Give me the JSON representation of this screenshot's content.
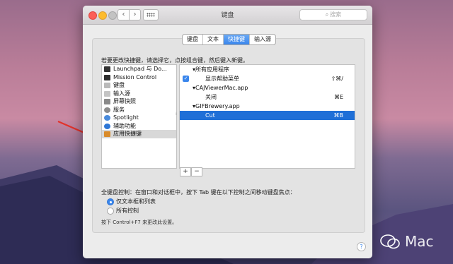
{
  "window": {
    "title": "键盘",
    "search_placeholder": "搜索",
    "nav_back": "‹",
    "nav_forward": "›"
  },
  "tabs": [
    {
      "label": "键盘",
      "active": false
    },
    {
      "label": "文本",
      "active": false
    },
    {
      "label": "快捷键",
      "active": true
    },
    {
      "label": "输入源",
      "active": false
    }
  ],
  "instruction": "若要更改快捷键，请选择它，点按组合键，然后键入新键。",
  "categories": [
    {
      "label": "Launchpad 与 Do...",
      "icon": "launchpad-icon",
      "color": "#333333",
      "selected": false
    },
    {
      "label": "Mission Control",
      "icon": "mission-control-icon",
      "color": "#2d2d2d",
      "selected": false
    },
    {
      "label": "键盘",
      "icon": "keyboard-icon",
      "color": "#b9b9b9",
      "selected": false
    },
    {
      "label": "输入源",
      "icon": "input-source-icon",
      "color": "#c4c4c4",
      "selected": false
    },
    {
      "label": "屏幕快照",
      "icon": "screenshot-icon",
      "color": "#8a8a8a",
      "selected": false
    },
    {
      "label": "服务",
      "icon": "gear-icon",
      "color": "#8d8d8d",
      "selected": false
    },
    {
      "label": "Spotlight",
      "icon": "spotlight-icon",
      "color": "#4a8bdc",
      "selected": false
    },
    {
      "label": "辅助功能",
      "icon": "accessibility-icon",
      "color": "#2f77d6",
      "selected": false
    },
    {
      "label": "应用快捷键",
      "icon": "app-shortcuts-icon",
      "color": "#d98b2b",
      "selected": true
    }
  ],
  "shortcuts": [
    {
      "type": "group",
      "label": "▾所有应用程序"
    },
    {
      "type": "item",
      "label": "显示帮助菜单",
      "key": "⇧⌘/",
      "checked": true,
      "selected": false
    },
    {
      "type": "group",
      "label": "▾CAJViewerMac.app"
    },
    {
      "type": "item",
      "label": "关闭",
      "key": "⌘E",
      "checked": false,
      "selected": false
    },
    {
      "type": "group",
      "label": "▾GIFBrewery.app"
    },
    {
      "type": "item",
      "label": "Cut",
      "key": "⌘B",
      "checked": false,
      "selected": true
    }
  ],
  "buttons": {
    "add": "+",
    "remove": "−"
  },
  "keyboard_control": "全键盘控制：在窗口和对话框中，按下 Tab 键在以下控制之间移动键盘焦点：",
  "radios": [
    {
      "label": "仅文本框和列表",
      "on": true
    },
    {
      "label": "所有控制",
      "on": false
    }
  ],
  "hint": "按下 Control+F7 来更改此设置。",
  "help": "?",
  "watermark": "Mac",
  "accent": "#3a86ec"
}
